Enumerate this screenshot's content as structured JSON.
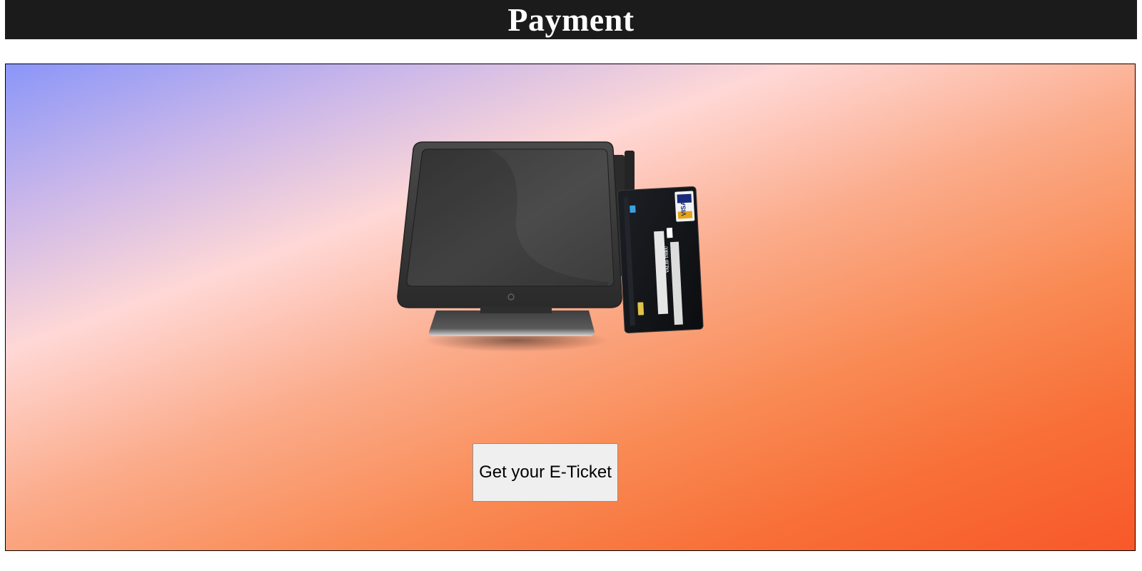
{
  "header": {
    "title": "Payment"
  },
  "main": {
    "illustration_icon": "pos-terminal-with-credit-card-icon",
    "card": {
      "brand": "VISA",
      "valid_thru": "VALID THRU"
    },
    "eticket_button_label": "Get your E-Ticket"
  },
  "colors": {
    "header_bg": "#1b1b1b",
    "header_text": "#ffffff",
    "gradient_start": "#8a96f8",
    "gradient_mid": "#ffd8d6",
    "gradient_end": "#f8582a",
    "button_bg": "#efefef"
  }
}
